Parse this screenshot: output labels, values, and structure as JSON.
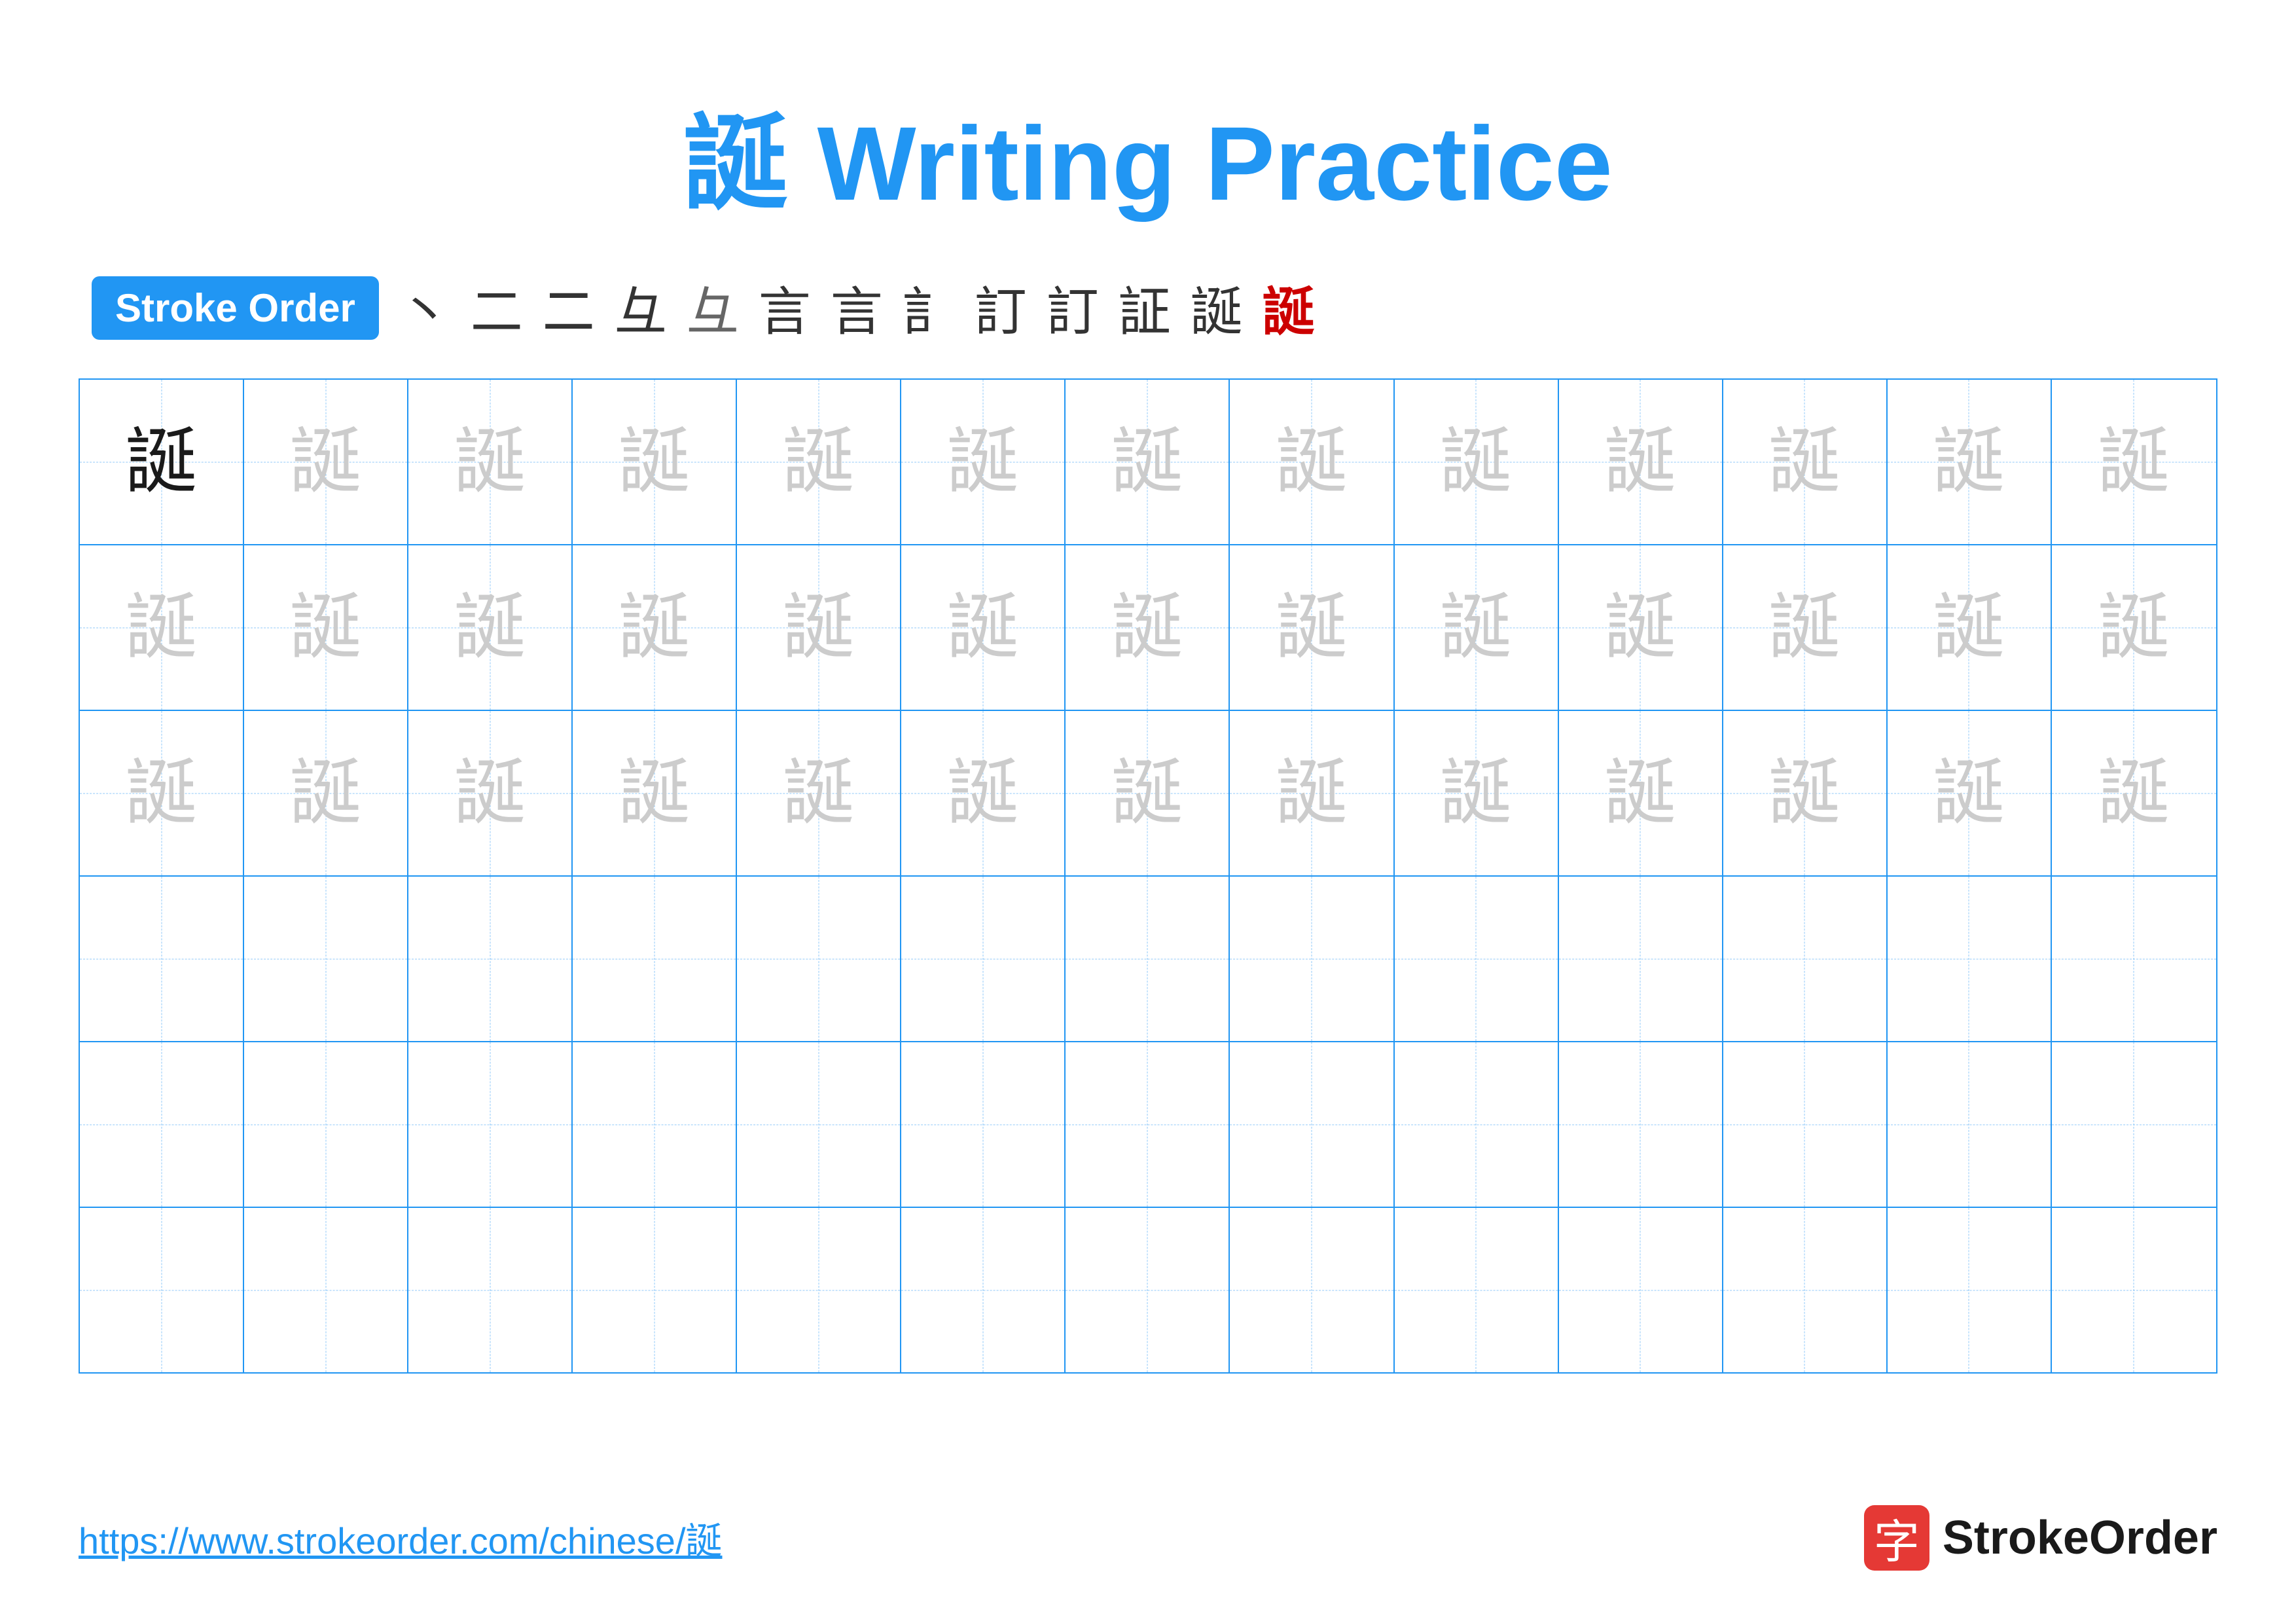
{
  "title": "誕 Writing Practice",
  "stroke_order_badge": "Stroke Order",
  "stroke_steps": [
    "丶",
    "二",
    "㆓",
    "彑",
    "彑",
    "言",
    "言",
    "訁",
    "訂",
    "訂",
    "証",
    "誕",
    "誕"
  ],
  "character": "誕",
  "rows": [
    {
      "type": "dark_then_light",
      "dark_count": 1,
      "light_count": 12
    },
    {
      "type": "light",
      "count": 13
    },
    {
      "type": "light",
      "count": 13
    },
    {
      "type": "empty"
    },
    {
      "type": "empty"
    },
    {
      "type": "empty"
    }
  ],
  "footer_url": "https://www.strokeorder.com/chinese/誕",
  "footer_logo_text": "StrokeOrder",
  "footer_logo_char": "字"
}
